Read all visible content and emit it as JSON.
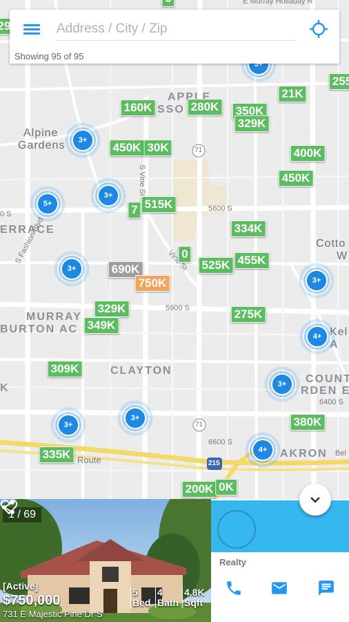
{
  "search": {
    "placeholder": "Address / City / Zip",
    "showing": "Showing 95 of 95"
  },
  "map": {
    "areas": [
      "APPLE",
      "SSO",
      "Alpine",
      "Gardens",
      "ERRACE",
      "MURRAY",
      "BURTON AC",
      "CLAYTON",
      "COUNT",
      "RDEN E",
      "AKRON",
      "Cotto",
      "W",
      "Kel",
      "A",
      "K"
    ],
    "streets": [
      "5600 S",
      "5900 S",
      "6400 S",
      "6600 S",
      "S Fashion Blvd",
      "S Vine St",
      "Vine St",
      "Route",
      "Bel",
      "0 S",
      "E Murray Holladay R",
      "71",
      "71",
      "71",
      "215"
    ],
    "price_markers": [
      {
        "label": "160K",
        "color": "green"
      },
      {
        "label": "280K",
        "color": "green"
      },
      {
        "label": "350K",
        "color": "green"
      },
      {
        "label": "329K",
        "color": "green"
      },
      {
        "label": "21K",
        "color": "green"
      },
      {
        "label": "255",
        "color": "green"
      },
      {
        "label": "450K",
        "color": "green"
      },
      {
        "label": "30K",
        "color": "green"
      },
      {
        "label": "400K",
        "color": "green"
      },
      {
        "label": "450K",
        "color": "green"
      },
      {
        "label": "7",
        "color": "green"
      },
      {
        "label": "515K",
        "color": "green"
      },
      {
        "label": "334K",
        "color": "green"
      },
      {
        "label": "0",
        "color": "green"
      },
      {
        "label": "525K",
        "color": "green"
      },
      {
        "label": "455K",
        "color": "green"
      },
      {
        "label": "690K",
        "color": "gray"
      },
      {
        "label": "750K",
        "color": "orange"
      },
      {
        "label": "329K",
        "color": "green"
      },
      {
        "label": "349K",
        "color": "green"
      },
      {
        "label": "275K",
        "color": "green"
      },
      {
        "label": "309K",
        "color": "green"
      },
      {
        "label": "380K",
        "color": "green"
      },
      {
        "label": "335K",
        "color": "green"
      },
      {
        "label": "200K",
        "color": "green"
      },
      {
        "label": "0K",
        "color": "green"
      },
      {
        "label": "29",
        "color": "green"
      },
      {
        "label": "0",
        "color": "green"
      }
    ],
    "clusters": [
      "3+",
      "3+",
      "5+",
      "3+",
      "3+",
      "3+",
      "4+",
      "3+",
      "3+",
      "3+",
      "4+"
    ]
  },
  "listing": {
    "counter": "1 / 69",
    "status": "[Active]",
    "price": "$750,000",
    "address": "731 E Majestic Pine Dr S",
    "beds_value": "5",
    "beds_label": "Bed",
    "baths_value": "4",
    "baths_label": "Bath",
    "sqft_value": "4.8K",
    "sqft_label": "Sqft"
  },
  "agent": {
    "company": "Realty"
  },
  "colors": {
    "accent": "#2196f3",
    "marker_green": "#5bbd5f",
    "marker_gray": "#9e9e9e",
    "marker_orange": "#f3a35a",
    "agent_header": "#36b7ee"
  }
}
